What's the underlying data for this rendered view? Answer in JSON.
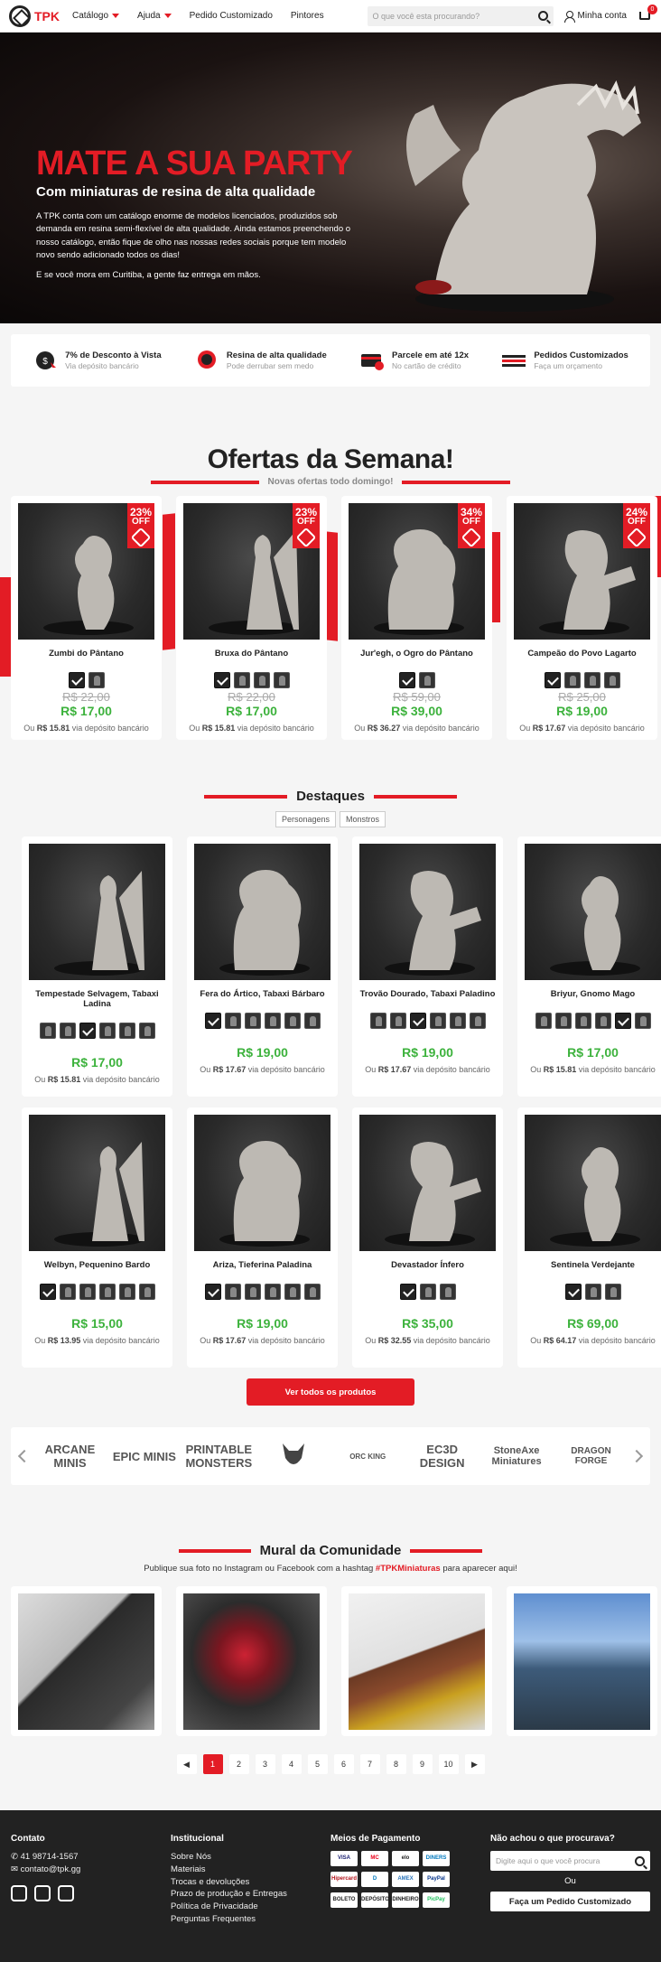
{
  "header": {
    "logo_text": "TPK",
    "nav": [
      "Catálogo",
      "Ajuda",
      "Pedido Customizado",
      "Pintores"
    ],
    "search_placeholder": "O que você esta procurando?",
    "account_label": "Minha conta",
    "cart_count": "0"
  },
  "hero": {
    "title": "MATE A SUA PARTY",
    "subtitle": "Com miniaturas de resina de alta qualidade",
    "paragraph1": "A TPK conta com um catálogo enorme de modelos licenciados, produzidos sob demanda em resina semi-flexível de alta qualidade. Ainda estamos preenchendo o nosso catálogo, então fique de olho nas nossas redes sociais porque tem modelo novo sendo adicionado todos os dias!",
    "paragraph2": "E se você mora em Curitiba, a gente faz entrega em mãos."
  },
  "features": [
    {
      "icon": "discount-icon",
      "title": "7% de Desconto à Vista",
      "sub": "Via depósito bancário"
    },
    {
      "icon": "quality-badge-icon",
      "title": "Resina de alta qualidade",
      "sub": "Pode derrubar sem medo"
    },
    {
      "icon": "credit-card-icon",
      "title": "Parcele em até 12x",
      "sub": "No cartão de crédito"
    },
    {
      "icon": "custom-order-icon",
      "title": "Pedidos Customizados",
      "sub": "Faça um orçamento"
    }
  ],
  "offers": {
    "title": "Ofertas da Semana!",
    "subtitle": "Novas ofertas todo domingo!",
    "products": [
      {
        "name": "Zumbi do Pântano",
        "discount": "23%",
        "off": "OFF",
        "old": "R$ 22,00",
        "price": "R$ 17,00",
        "inst_pre": "Ou ",
        "inst_val": "R$ 15.81",
        "inst_post": " via depósito bancário",
        "swatches": 2
      },
      {
        "name": "Bruxa do Pântano",
        "discount": "23%",
        "off": "OFF",
        "old": "R$ 22,00",
        "price": "R$ 17,00",
        "inst_pre": "Ou ",
        "inst_val": "R$ 15.81",
        "inst_post": " via depósito bancário",
        "swatches": 4
      },
      {
        "name": "Jur'egh, o Ogro do Pântano",
        "discount": "34%",
        "off": "OFF",
        "old": "R$ 59,00",
        "price": "R$ 39,00",
        "inst_pre": "Ou ",
        "inst_val": "R$ 36.27",
        "inst_post": " via depósito bancário",
        "swatches": 2
      },
      {
        "name": "Campeão do Povo Lagarto",
        "discount": "24%",
        "off": "OFF",
        "old": "R$ 25,00",
        "price": "R$ 19,00",
        "inst_pre": "Ou ",
        "inst_val": "R$ 17.67",
        "inst_post": " via depósito bancário",
        "swatches": 4
      }
    ]
  },
  "featured": {
    "title": "Destaques",
    "tabs": [
      "Personagens",
      "Monstros"
    ],
    "products": [
      {
        "name": "Tempestade Selvagem, Tabaxi Ladina",
        "price": "R$ 17,00",
        "inst_pre": "Ou ",
        "inst_val": "R$ 15.81",
        "inst_post": " via depósito bancário",
        "swatches": 6,
        "sel": 2
      },
      {
        "name": "Fera do Ártico, Tabaxi Bárbaro",
        "price": "R$ 19,00",
        "inst_pre": "Ou ",
        "inst_val": "R$ 17.67",
        "inst_post": " via depósito bancário",
        "swatches": 6,
        "sel": 0
      },
      {
        "name": "Trovão Dourado, Tabaxi Paladino",
        "price": "R$ 19,00",
        "inst_pre": "Ou ",
        "inst_val": "R$ 17.67",
        "inst_post": " via depósito bancário",
        "swatches": 6,
        "sel": 2
      },
      {
        "name": "Briyur, Gnomo Mago",
        "price": "R$ 17,00",
        "inst_pre": "Ou ",
        "inst_val": "R$ 15.81",
        "inst_post": " via depósito bancário",
        "swatches": 6,
        "sel": 4
      },
      {
        "name": "Welbyn, Pequenino Bardo",
        "price": "R$ 15,00",
        "inst_pre": "Ou ",
        "inst_val": "R$ 13.95",
        "inst_post": " via depósito bancário",
        "swatches": 6,
        "sel": 0
      },
      {
        "name": "Ariza, Tieferina Paladina",
        "price": "R$ 19,00",
        "inst_pre": "Ou ",
        "inst_val": "R$ 17.67",
        "inst_post": " via depósito bancário",
        "swatches": 6,
        "sel": 0
      },
      {
        "name": "Devastador Ínfero",
        "price": "R$ 35,00",
        "inst_pre": "Ou ",
        "inst_val": "R$ 32.55",
        "inst_post": " via depósito bancário",
        "swatches": 3,
        "sel": 0
      },
      {
        "name": "Sentinela Verdejante",
        "price": "R$ 69,00",
        "inst_pre": "Ou ",
        "inst_val": "R$ 64.17",
        "inst_post": " via depósito bancário",
        "swatches": 3,
        "sel": 0
      }
    ],
    "view_all": "Ver todos os produtos"
  },
  "brands": [
    "ARCANE MINIS",
    "EPIC MINIS",
    "PRINTABLE MONSTERS",
    "",
    "ORC KING",
    "EC3D DESIGN",
    "StoneAxe Miniatures",
    "DRAGON FORGE"
  ],
  "mural": {
    "title": "Mural da Comunidade",
    "sub_pre": "Publique sua foto no Instagram ou Facebook com a hashtag ",
    "hashtag": "#TPKMiniaturas",
    "sub_post": " para aparecer aqui!",
    "pages": [
      "1",
      "2",
      "3",
      "4",
      "5",
      "6",
      "7",
      "8",
      "9",
      "10"
    ],
    "prev": "◀",
    "next": "▶"
  },
  "footer": {
    "contact_title": "Contato",
    "phone": "41 98714-1567",
    "email": "contato@tpk.gg",
    "inst_title": "Institucional",
    "links": [
      "Sobre Nós",
      "Materiais",
      "Trocas e devoluções",
      "Prazo de produção e Entregas",
      "Política de Privacidade",
      "Perguntas Frequentes"
    ],
    "pay_title": "Meios de Pagamento",
    "pays": [
      "VISA",
      "MC",
      "elo",
      "DINERS",
      "Hipercard",
      "D",
      "AMEX",
      "PayPal",
      "BOLETO",
      "DEPÓSITO",
      "DINHEIRO",
      "PicPay"
    ],
    "search_title": "Não achou o que procurava?",
    "search_placeholder": "Digite aqui o que você procura",
    "or": "Ou",
    "custom_btn": "Faça um Pedido Customizado"
  }
}
